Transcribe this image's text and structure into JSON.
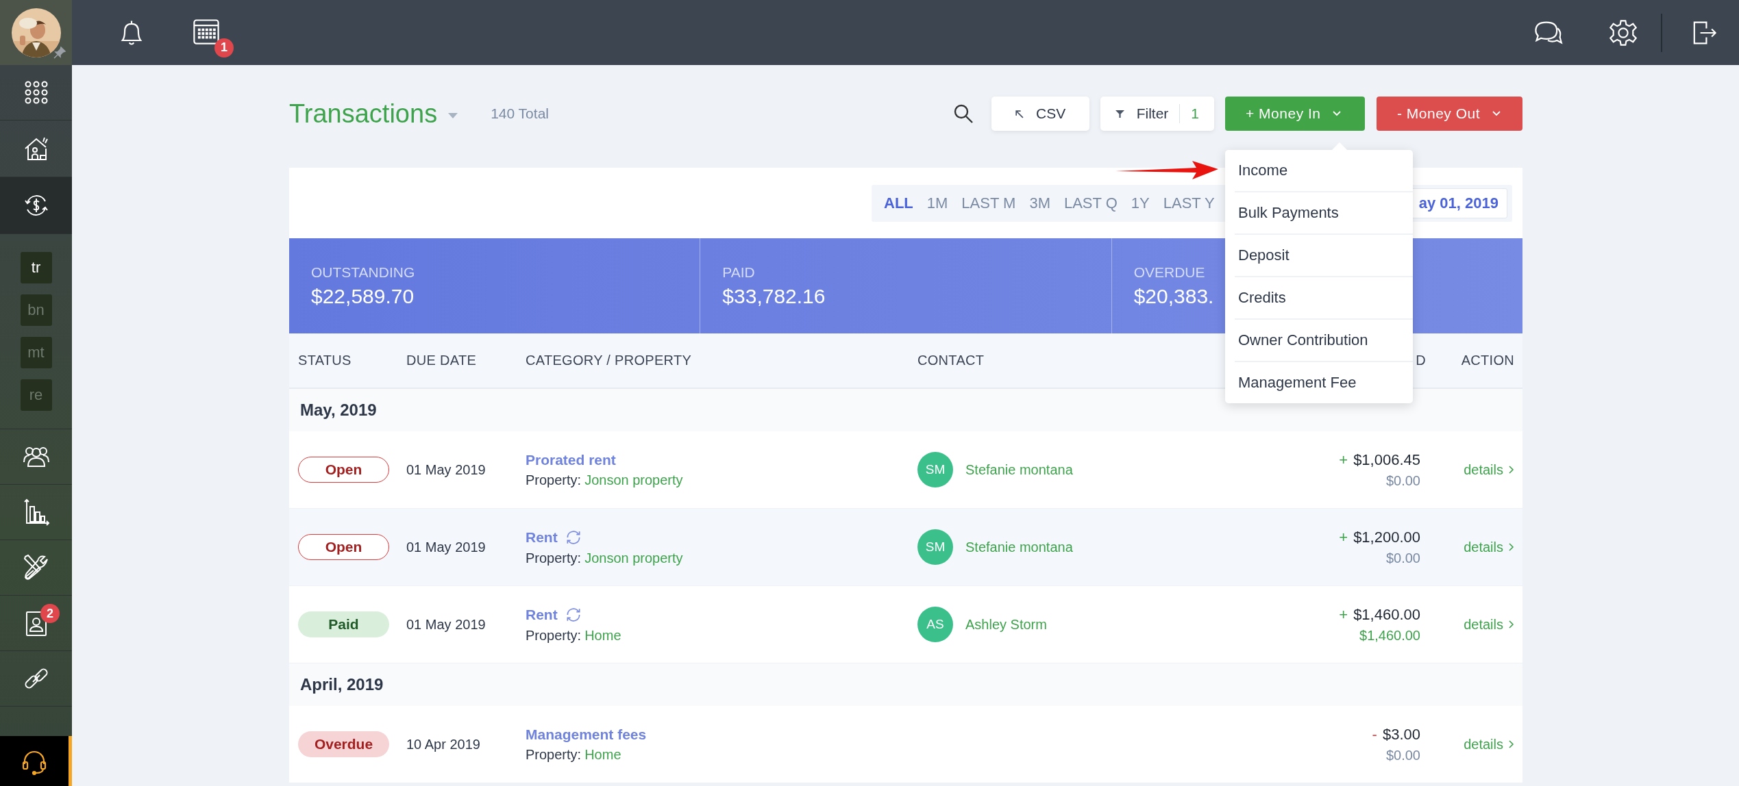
{
  "topbar": {
    "calendar_badge": "1"
  },
  "sidebar": {
    "items": [
      {
        "kind": "apps",
        "selected": false
      },
      {
        "kind": "home",
        "selected": false
      },
      {
        "kind": "transactions",
        "selected": true
      },
      {
        "kind": "shortcuts",
        "children": [
          {
            "label": "tr",
            "selected": true
          },
          {
            "label": "bn",
            "selected": false
          },
          {
            "label": "mt",
            "selected": false
          },
          {
            "label": "re",
            "selected": false
          }
        ]
      },
      {
        "kind": "people",
        "selected": false
      },
      {
        "kind": "chart",
        "selected": false
      },
      {
        "kind": "tools",
        "selected": false
      },
      {
        "kind": "contact",
        "selected": false,
        "badge": "2"
      },
      {
        "kind": "link",
        "selected": false
      }
    ]
  },
  "header": {
    "title": "Transactions",
    "total": "140 Total",
    "csv_button": "CSV",
    "filter_button": {
      "label": "Filter",
      "count": "1"
    },
    "money_in_button": "+ Money In",
    "money_out_button": "- Money Out"
  },
  "money_in_menu": [
    "Income",
    "Bulk Payments",
    "Deposit",
    "Credits",
    "Owner Contribution",
    "Management Fee"
  ],
  "periods": [
    {
      "label": "ALL",
      "selected": true
    },
    {
      "label": "1M",
      "selected": false
    },
    {
      "label": "LAST M",
      "selected": false
    },
    {
      "label": "3M",
      "selected": false
    },
    {
      "label": "LAST Q",
      "selected": false
    },
    {
      "label": "1Y",
      "selected": false
    },
    {
      "label": "LAST Y",
      "selected": false
    }
  ],
  "date_field": "ay 01, 2019",
  "summary": [
    {
      "label": "OUTSTANDING",
      "value": "$22,589.70"
    },
    {
      "label": "PAID",
      "value": "$33,782.16"
    },
    {
      "label": "OVERDUE",
      "value": "$20,383."
    }
  ],
  "table": {
    "columns": [
      "STATUS",
      "DUE DATE",
      "CATEGORY / PROPERTY",
      "CONTACT",
      "D",
      "ACTION"
    ],
    "groups": [
      {
        "title": "May, 2019",
        "rows": [
          {
            "status": "Open",
            "kind": "open",
            "due": "01 May 2019",
            "category": "Prorated rent",
            "recurring": false,
            "property_label": "Property:",
            "property": "Jonson property",
            "contact": {
              "initials": "SM",
              "name": "Stefanie montana"
            },
            "sign": {
              "text": "+",
              "color": "#3fa34d"
            },
            "amount": "$1,006.45",
            "received": "$0.00",
            "settled": false,
            "action": "details"
          },
          {
            "status": "Open",
            "kind": "open",
            "due": "01 May 2019",
            "category": "Rent",
            "recurring": true,
            "property_label": "Property:",
            "property": "Jonson property",
            "contact": {
              "initials": "SM",
              "name": "Stefanie montana"
            },
            "sign": {
              "text": "+",
              "color": "#3fa34d"
            },
            "amount": "$1,200.00",
            "received": "$0.00",
            "settled": false,
            "action": "details"
          },
          {
            "status": "Paid",
            "kind": "paid",
            "due": "01 May 2019",
            "category": "Rent",
            "recurring": true,
            "property_label": "Property:",
            "property": "Home",
            "contact": {
              "initials": "AS",
              "name": "Ashley Storm"
            },
            "sign": {
              "text": "+",
              "color": "#3fa34d"
            },
            "amount": "$1,460.00",
            "received": "$1,460.00",
            "settled": true,
            "action": "details"
          }
        ]
      },
      {
        "title": "April, 2019",
        "rows": [
          {
            "status": "Overdue",
            "kind": "overdue",
            "due": "10 Apr 2019",
            "category": "Management fees",
            "recurring": false,
            "property_label": "Property:",
            "property": "Home",
            "sign": {
              "text": "-",
              "color": "#e04444"
            },
            "amount": "$3.00",
            "received": "$0.00",
            "settled": false,
            "action": "details"
          }
        ]
      }
    ]
  }
}
